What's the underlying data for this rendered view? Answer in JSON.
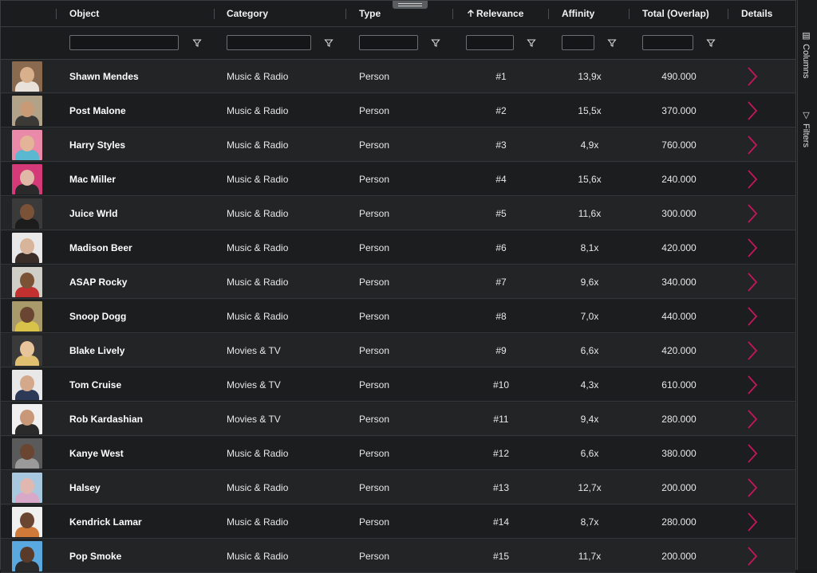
{
  "columns": [
    {
      "label": "Object"
    },
    {
      "label": "Category"
    },
    {
      "label": "Type"
    },
    {
      "label": "Relevance",
      "sort": "ascending"
    },
    {
      "label": "Affinity"
    },
    {
      "label": "Total (Overlap)"
    },
    {
      "label": "Details"
    }
  ],
  "filters": {
    "object": "",
    "category": "",
    "type": "",
    "relevance": "",
    "affinity": "",
    "total": ""
  },
  "rows": [
    {
      "name": "Shawn Mendes",
      "category": "Music & Radio",
      "type": "Person",
      "relevance": "#1",
      "affinity": "13,9x",
      "total": "490.000",
      "colors": {
        "bg": "#8a6a4e",
        "skin": "#d9b08c",
        "top": "#e8e2da"
      }
    },
    {
      "name": "Post Malone",
      "category": "Music & Radio",
      "type": "Person",
      "relevance": "#2",
      "affinity": "15,5x",
      "total": "370.000",
      "colors": {
        "bg": "#b0a38a",
        "skin": "#c89a76",
        "top": "#3b3a36"
      }
    },
    {
      "name": "Harry Styles",
      "category": "Music & Radio",
      "type": "Person",
      "relevance": "#3",
      "affinity": "4,9x",
      "total": "760.000",
      "colors": {
        "bg": "#e88aa8",
        "skin": "#e3b497",
        "top": "#5ab8d0"
      }
    },
    {
      "name": "Mac Miller",
      "category": "Music & Radio",
      "type": "Person",
      "relevance": "#4",
      "affinity": "15,6x",
      "total": "240.000",
      "colors": {
        "bg": "#d43a78",
        "skin": "#e0b8a8",
        "top": "#2a2a2a"
      }
    },
    {
      "name": "Juice Wrld",
      "category": "Music & Radio",
      "type": "Person",
      "relevance": "#5",
      "affinity": "11,6x",
      "total": "300.000",
      "colors": {
        "bg": "#3a3a3a",
        "skin": "#7a5238",
        "top": "#1c1c1c"
      }
    },
    {
      "name": "Madison Beer",
      "category": "Music & Radio",
      "type": "Person",
      "relevance": "#6",
      "affinity": "8,1x",
      "total": "420.000",
      "colors": {
        "bg": "#e8e8e8",
        "skin": "#d8b49a",
        "top": "#3a2c26"
      }
    },
    {
      "name": "ASAP Rocky",
      "category": "Music & Radio",
      "type": "Person",
      "relevance": "#7",
      "affinity": "9,6x",
      "total": "340.000",
      "colors": {
        "bg": "#cfcfc8",
        "skin": "#7a5236",
        "top": "#c23030"
      }
    },
    {
      "name": "Snoop Dogg",
      "category": "Music & Radio",
      "type": "Person",
      "relevance": "#8",
      "affinity": "7,0x",
      "total": "440.000",
      "colors": {
        "bg": "#a89a6a",
        "skin": "#6a4632",
        "top": "#d8c24a"
      }
    },
    {
      "name": "Blake Lively",
      "category": "Movies & TV",
      "type": "Person",
      "relevance": "#9",
      "affinity": "6,6x",
      "total": "420.000",
      "colors": {
        "bg": "#3a3a3a",
        "skin": "#e8c49a",
        "top": "#e0c070"
      }
    },
    {
      "name": "Tom Cruise",
      "category": "Movies & TV",
      "type": "Person",
      "relevance": "#10",
      "affinity": "4,3x",
      "total": "610.000",
      "colors": {
        "bg": "#e8e8e8",
        "skin": "#d4a88a",
        "top": "#2c3a58"
      }
    },
    {
      "name": "Rob Kardashian",
      "category": "Movies & TV",
      "type": "Person",
      "relevance": "#11",
      "affinity": "9,4x",
      "total": "280.000",
      "colors": {
        "bg": "#f0f0f0",
        "skin": "#c89878",
        "top": "#2a2a2a"
      }
    },
    {
      "name": "Kanye West",
      "category": "Music & Radio",
      "type": "Person",
      "relevance": "#12",
      "affinity": "6,6x",
      "total": "380.000",
      "colors": {
        "bg": "#5a5a5a",
        "skin": "#6a4632",
        "top": "#9a9a9a"
      }
    },
    {
      "name": "Halsey",
      "category": "Music & Radio",
      "type": "Person",
      "relevance": "#13",
      "affinity": "12,7x",
      "total": "200.000",
      "colors": {
        "bg": "#a8c8e0",
        "skin": "#e0b8b0",
        "top": "#d8a8c8"
      }
    },
    {
      "name": "Kendrick Lamar",
      "category": "Music & Radio",
      "type": "Person",
      "relevance": "#14",
      "affinity": "8,7x",
      "total": "280.000",
      "colors": {
        "bg": "#f0f0f0",
        "skin": "#6a4632",
        "top": "#d07a3a"
      }
    },
    {
      "name": "Pop Smoke",
      "category": "Music & Radio",
      "type": "Person",
      "relevance": "#15",
      "affinity": "11,7x",
      "total": "200.000",
      "colors": {
        "bg": "#5aa8e0",
        "skin": "#5a3a28",
        "top": "#2a2a2a"
      }
    }
  ],
  "side_panel": {
    "columns_label": "Columns",
    "filters_label": "Filters"
  },
  "accent_color": "#c2185b"
}
